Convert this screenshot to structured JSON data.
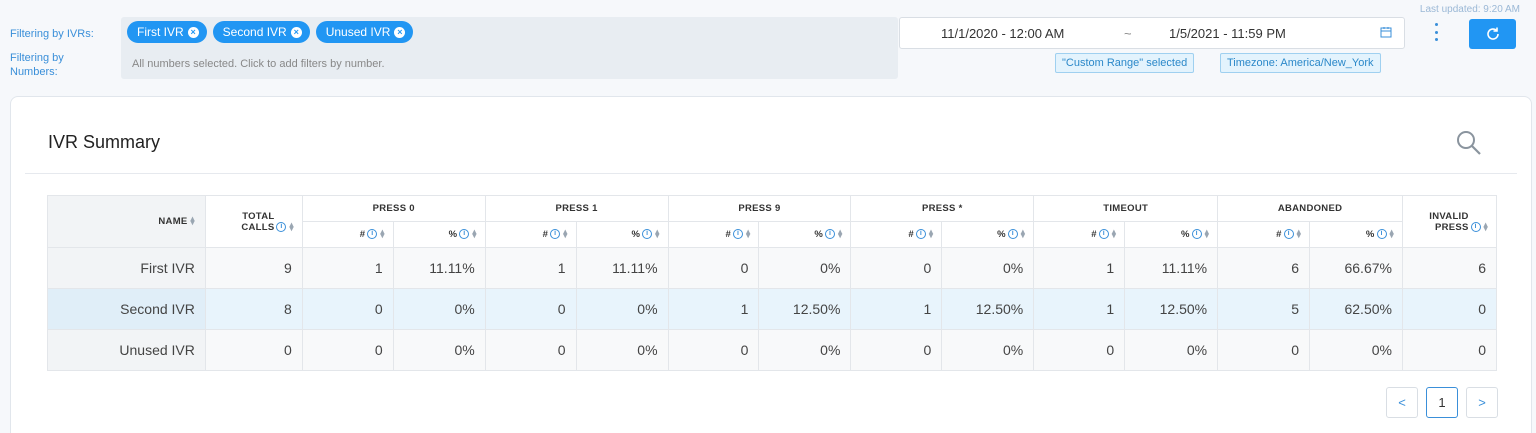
{
  "header": {
    "last_updated": "Last updated: 9:20 AM",
    "filter_ivr_label": "Filtering by IVRs:",
    "filter_numbers_label": "Filtering by Numbers:",
    "ivr_chips": [
      "First IVR",
      "Second IVR",
      "Unused IVR"
    ],
    "numbers_hint": "All numbers selected. Click to add filters by number.",
    "date_start": "11/1/2020 - 12:00 AM",
    "date_sep": "~",
    "date_end": "1/5/2021 - 11:59 PM",
    "range_tag": "\"Custom Range\" selected",
    "timezone_tag": "Timezone: America/New_York"
  },
  "card": {
    "title": "IVR Summary"
  },
  "table": {
    "columns": {
      "name": "NAME",
      "total_calls": "TOTAL CALLS",
      "groups": [
        "PRESS 0",
        "PRESS 1",
        "PRESS 9",
        "PRESS *",
        "TIMEOUT",
        "ABANDONED"
      ],
      "count": "#",
      "percent": "%",
      "invalid": "INVALID PRESS"
    },
    "rows": [
      {
        "name": "First IVR",
        "total": "9",
        "vals": [
          "1",
          "11.11%",
          "1",
          "11.11%",
          "0",
          "0%",
          "0",
          "0%",
          "1",
          "11.11%",
          "6",
          "66.67%"
        ],
        "invalid": "6"
      },
      {
        "name": "Second IVR",
        "total": "8",
        "vals": [
          "0",
          "0%",
          "0",
          "0%",
          "1",
          "12.50%",
          "1",
          "12.50%",
          "1",
          "12.50%",
          "5",
          "62.50%"
        ],
        "invalid": "0"
      },
      {
        "name": "Unused IVR",
        "total": "0",
        "vals": [
          "0",
          "0%",
          "0",
          "0%",
          "0",
          "0%",
          "0",
          "0%",
          "0",
          "0%",
          "0",
          "0%"
        ],
        "invalid": "0"
      }
    ]
  },
  "pagination": {
    "prev": "<",
    "current": "1",
    "next": ">"
  },
  "colors": {
    "accent": "#2196f3",
    "selected_row": "#e8f4fc"
  }
}
